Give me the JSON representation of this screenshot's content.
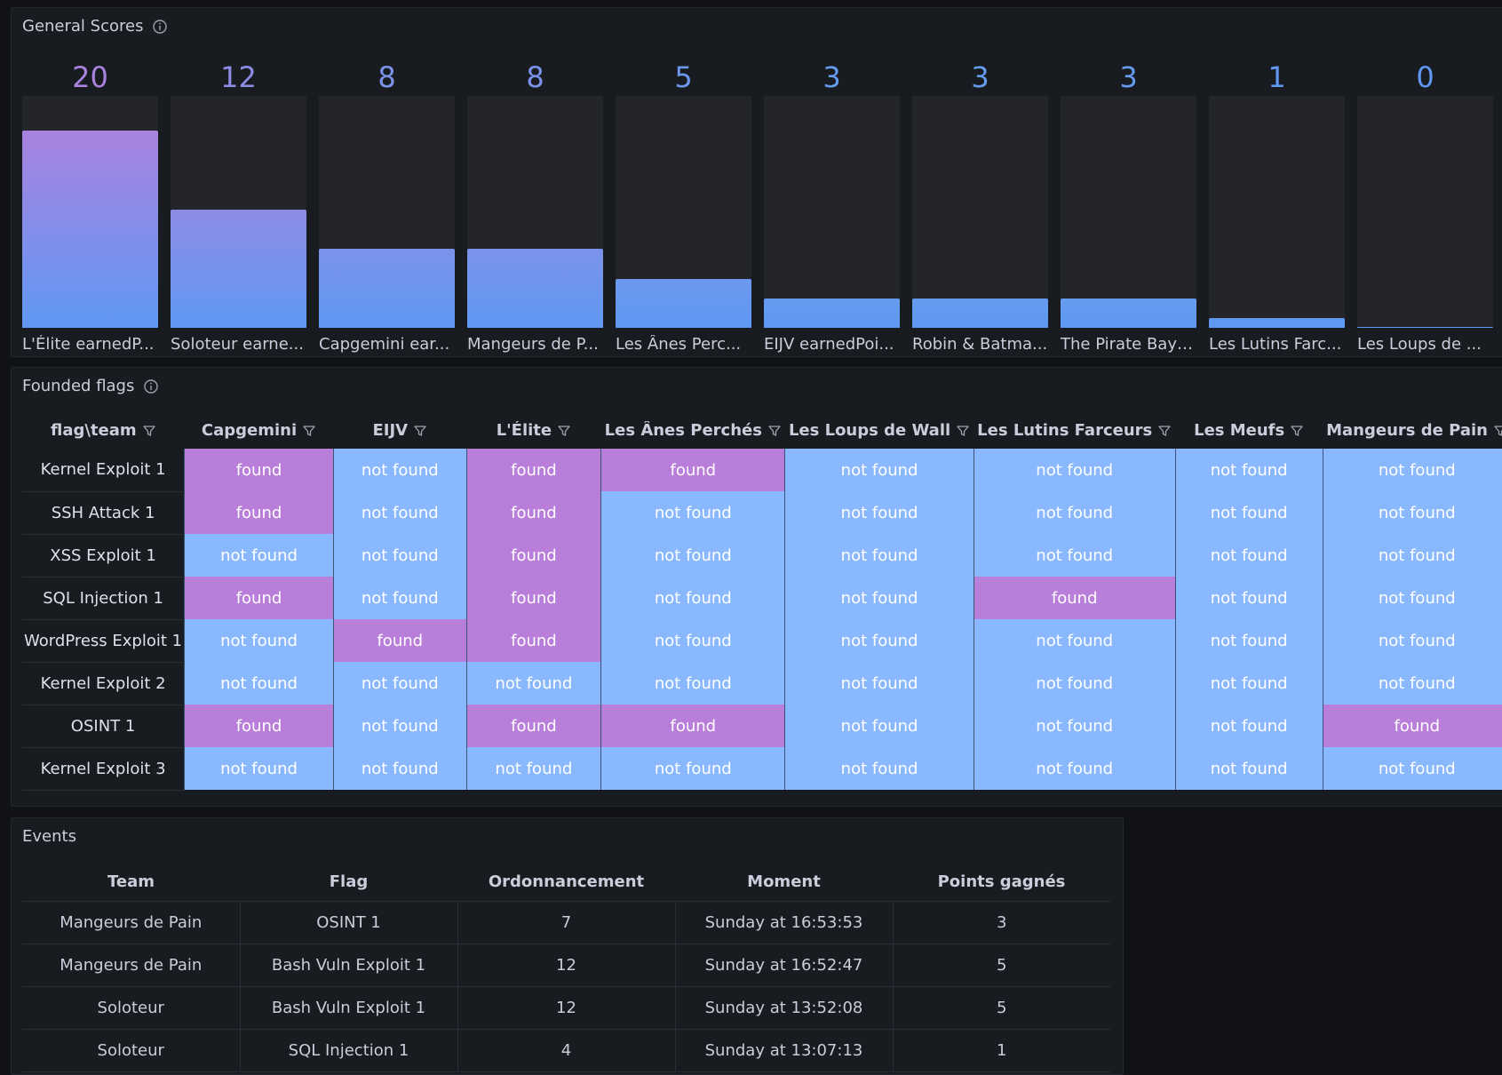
{
  "scores_panel": {
    "title": "General Scores",
    "max": 20,
    "bars": [
      {
        "value": 20,
        "label": "L'Élite earnedP...",
        "color": "#a883df"
      },
      {
        "value": 12,
        "label": "Soloteur earne...",
        "color": "#8d8ce5"
      },
      {
        "value": 8,
        "label": "Capgemini ear...",
        "color": "#7b93ea"
      },
      {
        "value": 8,
        "label": "Mangeurs de P...",
        "color": "#7b93ea"
      },
      {
        "value": 5,
        "label": "Les Ânes Perc...",
        "color": "#6d98ee"
      },
      {
        "value": 3,
        "label": "EIJV earnedPoi...",
        "color": "#669cf0"
      },
      {
        "value": 3,
        "label": "Robin & Batma...",
        "color": "#669cf0"
      },
      {
        "value": 3,
        "label": "The Pirate Bay ...",
        "color": "#669cf0"
      },
      {
        "value": 1,
        "label": "Les Lutins Farc...",
        "color": "#6199f2"
      },
      {
        "value": 0,
        "label": "Les Loups de ...",
        "color": "#5f98f4"
      }
    ]
  },
  "flags_panel": {
    "title": "Founded flags",
    "columns": [
      "flag\\team",
      "Capgemini",
      "EIJV",
      "L'Élite",
      "Les Ânes Perchés",
      "Les Loups de Wall",
      "Les Lutins Farceurs",
      "Les Meufs",
      "Mangeurs de Pain"
    ],
    "rows": [
      {
        "flag": "Kernel Exploit 1",
        "cells": [
          "found",
          "not found",
          "found",
          "found",
          "not found",
          "not found",
          "not found",
          "not found"
        ]
      },
      {
        "flag": "SSH Attack 1",
        "cells": [
          "found",
          "not found",
          "found",
          "not found",
          "not found",
          "not found",
          "not found",
          "not found"
        ]
      },
      {
        "flag": "XSS Exploit 1",
        "cells": [
          "not found",
          "not found",
          "found",
          "not found",
          "not found",
          "not found",
          "not found",
          "not found"
        ]
      },
      {
        "flag": "SQL Injection 1",
        "cells": [
          "found",
          "not found",
          "found",
          "not found",
          "not found",
          "found",
          "not found",
          "not found"
        ]
      },
      {
        "flag": "WordPress Exploit 1",
        "cells": [
          "not found",
          "found",
          "found",
          "not found",
          "not found",
          "not found",
          "not found",
          "not found"
        ]
      },
      {
        "flag": "Kernel Exploit 2",
        "cells": [
          "not found",
          "not found",
          "not found",
          "not found",
          "not found",
          "not found",
          "not found",
          "not found"
        ]
      },
      {
        "flag": "OSINT 1",
        "cells": [
          "found",
          "not found",
          "found",
          "found",
          "not found",
          "not found",
          "not found",
          "found"
        ]
      },
      {
        "flag": "Kernel Exploit 3",
        "cells": [
          "not found",
          "not found",
          "not found",
          "not found",
          "not found",
          "not found",
          "not found",
          "not found"
        ]
      }
    ]
  },
  "events_panel": {
    "title": "Events",
    "columns": [
      "Team",
      "Flag",
      "Ordonnancement",
      "Moment",
      "Points gagnés"
    ],
    "rows": [
      [
        "Mangeurs de Pain",
        "OSINT 1",
        "7",
        "Sunday at 16:53:53",
        "3"
      ],
      [
        "Mangeurs de Pain",
        "Bash Vuln Exploit 1",
        "12",
        "Sunday at 16:52:47",
        "5"
      ],
      [
        "Soloteur",
        "Bash Vuln Exploit 1",
        "12",
        "Sunday at 13:52:08",
        "5"
      ],
      [
        "Soloteur",
        "SQL Injection 1",
        "4",
        "Sunday at 13:07:13",
        "1"
      ]
    ]
  }
}
